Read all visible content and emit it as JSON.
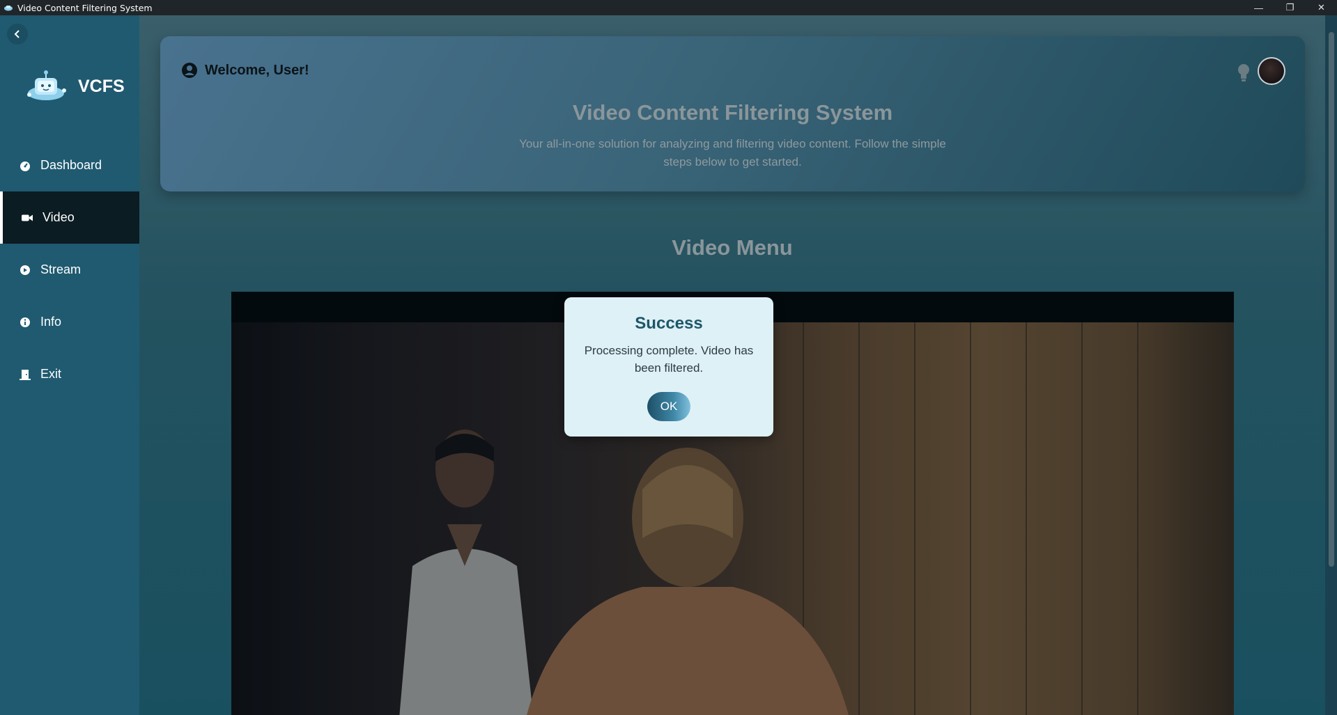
{
  "window": {
    "title": "Video Content Filtering System",
    "controls": {
      "minimize": "—",
      "restore": "❐",
      "close": "✕"
    }
  },
  "sidebar": {
    "brand": "VCFS",
    "items": [
      {
        "label": "Dashboard",
        "icon": "gauge-icon"
      },
      {
        "label": "Video",
        "icon": "video-camera-icon",
        "active": true
      },
      {
        "label": "Stream",
        "icon": "play-circle-icon"
      },
      {
        "label": "Info",
        "icon": "info-circle-icon"
      },
      {
        "label": "Exit",
        "icon": "door-exit-icon"
      }
    ]
  },
  "header": {
    "welcome": "Welcome, User!",
    "title": "Video Content Filtering System",
    "subtitle": "Your all-in-one solution for analyzing and filtering video content. Follow the simple steps below to get started."
  },
  "main": {
    "section_title": "Video Menu"
  },
  "dialog": {
    "title": "Success",
    "message": "Processing complete. Video has been filtered.",
    "ok_label": "OK"
  },
  "colors": {
    "sidebar": "#1f5a70",
    "active_nav": "#0b1c23",
    "dialog_bg": "#def1f6",
    "dialog_title": "#1e5669"
  }
}
